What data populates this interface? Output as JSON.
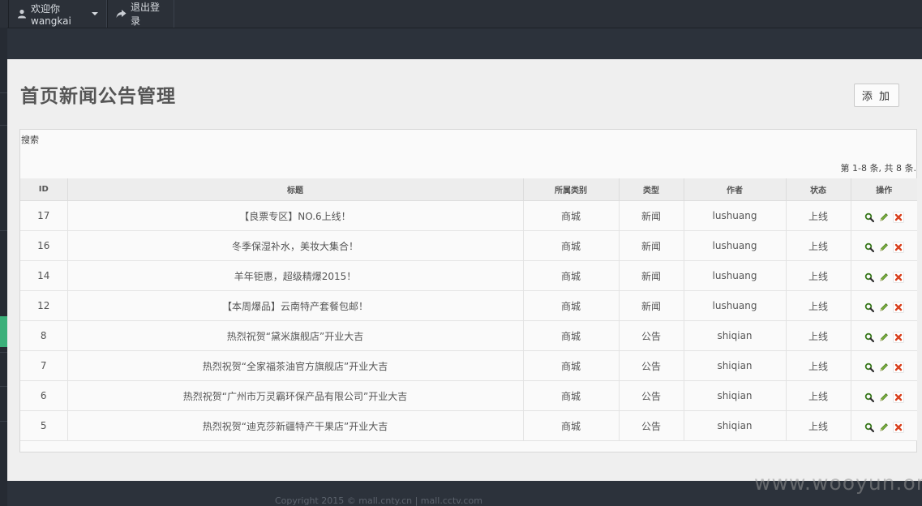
{
  "topbar": {
    "user_label": "欢迎你wangkai",
    "logout_label": "退出登录"
  },
  "page": {
    "title": "首页新闻公告管理",
    "add_label": "添 加",
    "search_label": "搜索",
    "page_info": "第 1-8 条, 共 8 条."
  },
  "table": {
    "headers": [
      "ID",
      "标题",
      "所属类别",
      "类型",
      "作者",
      "状态",
      "操作"
    ],
    "rows": [
      {
        "id": "17",
        "title": "【良票专区】NO.6上线！",
        "category": "商城",
        "type": "新闻",
        "author": "lushuang",
        "status": "上线"
      },
      {
        "id": "16",
        "title": "冬季保湿补水，美妆大集合！",
        "category": "商城",
        "type": "新闻",
        "author": "lushuang",
        "status": "上线"
      },
      {
        "id": "14",
        "title": "羊年钜惠，超级精爆2015！",
        "category": "商城",
        "type": "新闻",
        "author": "lushuang",
        "status": "上线"
      },
      {
        "id": "12",
        "title": "【本周爆品】云南特产套餐包邮！",
        "category": "商城",
        "type": "新闻",
        "author": "lushuang",
        "status": "上线"
      },
      {
        "id": "8",
        "title": "热烈祝贺“黛米旗舰店”开业大吉",
        "category": "商城",
        "type": "公告",
        "author": "shiqian",
        "status": "上线"
      },
      {
        "id": "7",
        "title": "热烈祝贺“全家福茶油官方旗舰店”开业大吉",
        "category": "商城",
        "type": "公告",
        "author": "shiqian",
        "status": "上线"
      },
      {
        "id": "6",
        "title": "热烈祝贺“广州市万灵霸环保产品有限公司”开业大吉",
        "category": "商城",
        "type": "公告",
        "author": "shiqian",
        "status": "上线"
      },
      {
        "id": "5",
        "title": "热烈祝贺“迪克莎新疆特产干果店”开业大吉",
        "category": "商城",
        "type": "公告",
        "author": "shiqian",
        "status": "上线"
      }
    ],
    "op_icons": [
      "view-icon",
      "edit-icon",
      "delete-icon"
    ]
  },
  "footer": {
    "copyright": "Copyright 2015 © mall.cnty.cn | mall.cctv.com"
  },
  "watermark": "www.wooyun.org",
  "colors": {
    "nav_bg": "#2b3038",
    "panel_bg": "#efefef",
    "accent_green": "#3bb07a",
    "delete_red": "#d9411e",
    "edit_green": "#6aa63a"
  }
}
